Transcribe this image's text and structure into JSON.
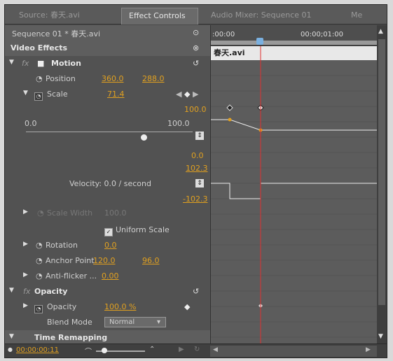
{
  "tabs": [
    {
      "label": "Source: 春天.avi"
    },
    {
      "label": "Effect Controls"
    },
    {
      "label": "Audio Mixer: Sequence 01"
    },
    {
      "label": "Me"
    }
  ],
  "sequence_title": "Sequence 01 * 春天.avi",
  "section_video": "Video Effects",
  "motion": {
    "label": "Motion",
    "position": {
      "label": "Position",
      "x": "360.0",
      "y": "288.0"
    },
    "scale": {
      "label": "Scale",
      "value": "71.4",
      "top_value": "100.0",
      "min": "0.0",
      "max": "100.0",
      "zero": "0.0",
      "vel_max": "102.3",
      "velocity": "Velocity: 0.0 / second",
      "vel_min": "-102.3"
    },
    "scale_width": {
      "label": "Scale Width",
      "value": "100.0"
    },
    "uniform_scale": "Uniform Scale",
    "rotation": {
      "label": "Rotation",
      "value": "0.0"
    },
    "anchor": {
      "label": "Anchor Point",
      "x": "120.0",
      "y": "96.0"
    },
    "antiflicker": {
      "label": "Anti-flicker ...",
      "value": "0.00"
    }
  },
  "opacity": {
    "label": "Opacity",
    "sub_label": "Opacity",
    "value": "100.0 %",
    "blend_label": "Blend Mode",
    "blend_value": "Normal"
  },
  "time_remapping": "Time Remapping",
  "timeline": {
    "start": ":00:00",
    "end": "00:00;01:00",
    "clip": "春天.avi"
  },
  "bottom": {
    "timecode": "00:00:00:11"
  }
}
